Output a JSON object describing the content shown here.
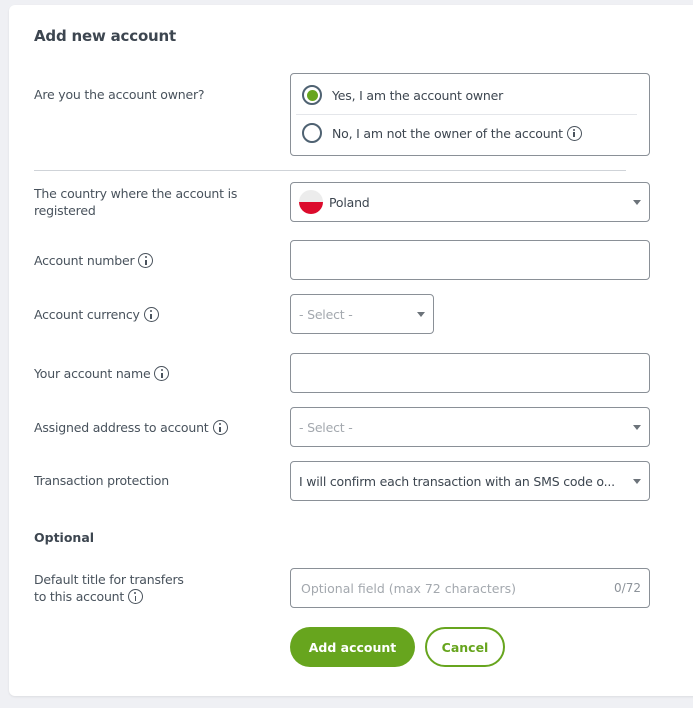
{
  "page": {
    "title": "Add new account"
  },
  "owner": {
    "label": "Are you the account owner?",
    "options": [
      {
        "label": "Yes, I am the account owner",
        "checked": true
      },
      {
        "label": "No, I am not the owner of the account",
        "checked": false,
        "info": true
      }
    ]
  },
  "country": {
    "label": "The country where the account is registered",
    "value": "Poland",
    "flag": "poland-flag"
  },
  "account_number": {
    "label": "Account number",
    "value": ""
  },
  "currency": {
    "label": "Account currency",
    "placeholder": "- Select -"
  },
  "account_name": {
    "label": "Your account name",
    "value": ""
  },
  "address": {
    "label": "Assigned address to account",
    "placeholder": "- Select -"
  },
  "protection": {
    "label": "Transaction protection",
    "value": "I will confirm each transaction with an SMS code o..."
  },
  "optional": {
    "section_title": "Optional",
    "default_title_label_line1": "Default title for transfers",
    "default_title_label_line2": "to this account",
    "placeholder": "Optional field (max 72 characters)",
    "counter": "0/72"
  },
  "actions": {
    "submit": "Add account",
    "cancel": "Cancel"
  },
  "colors": {
    "accent": "#67a51e",
    "background": "#eff0f4",
    "border": "#8a9097"
  }
}
